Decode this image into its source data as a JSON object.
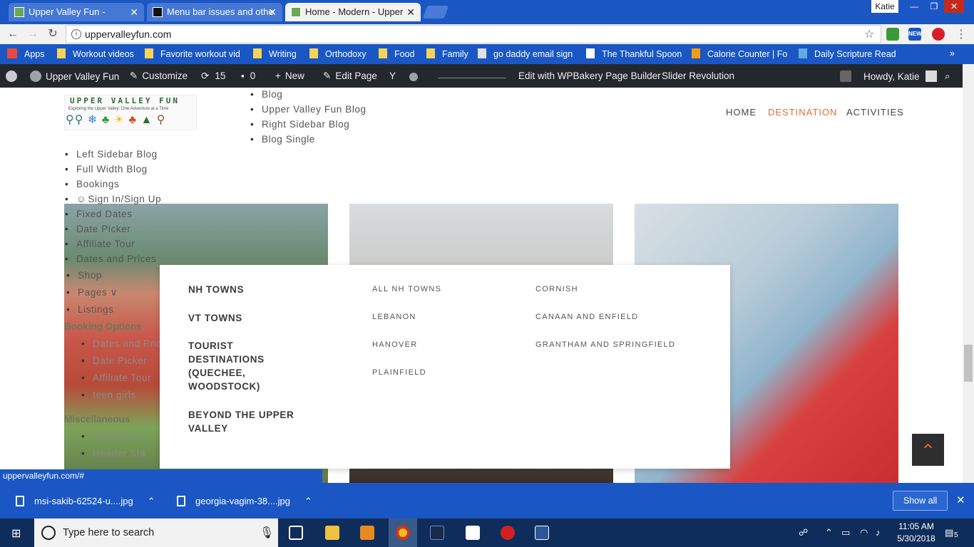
{
  "browser": {
    "tabs": [
      {
        "title": "Upper Valley Fun -",
        "active": false
      },
      {
        "title": "Menu bar issues and othe",
        "active": false
      },
      {
        "title": "Home - Modern - Upper",
        "active": true
      }
    ],
    "profile": "Katie",
    "url": "uppervalleyfun.com",
    "ext_new_label": "NEW"
  },
  "bookmarks": [
    "Apps",
    "Workout videos",
    "Favorite workout vid",
    "Writing",
    "Orthodoxy",
    "Food",
    "Family",
    "go daddy email sign",
    "The Thankful Spoon",
    "Calorie Counter | Fo",
    "Daily Scripture Read"
  ],
  "wpbar": {
    "site": "Upper Valley Fun",
    "customize": "Customize",
    "updates": "15",
    "comments": "0",
    "new": "New",
    "edit_page": "Edit Page",
    "wpbakery": "Edit with WPBakery Page Builder",
    "slider": "Slider Revolution",
    "howdy": "Howdy, Katie"
  },
  "site": {
    "logo_text": "UPPER VALLEY FUN",
    "logo_tagline": "Exploring the Upper Valley: One Adventure at a Time",
    "nav": [
      "HOME",
      "DESTINATION",
      "ACTIVITIES"
    ]
  },
  "overflow_list_top": [
    "Blog",
    "Upper Valley Fun Blog",
    "Right Sidebar Blog",
    "Blog Single"
  ],
  "overflow_list_left": [
    "Left Sidebar Blog",
    "Full Width Blog",
    "Bookings",
    "Sign In/Sign Up",
    "Fixed Dates",
    "Date Picker",
    "Affiliate Tour",
    "Dates and Prices"
  ],
  "overflow_list_left2": [
    "Shop",
    "Pages",
    "Listings"
  ],
  "booking_heading": "Booking Options",
  "booking_items": [
    "Dates and Price",
    "Date Picker",
    "Affiliate Tour",
    "teen girls"
  ],
  "misc_heading": "Miscellaneous",
  "misc_items": [
    "Contact Us",
    "Header Sta"
  ],
  "megamenu": {
    "main": [
      "NH TOWNS",
      "VT TOWNS",
      "TOURIST DESTINATIONS (QUECHEE, WOODSTOCK)",
      "BEYOND THE UPPER VALLEY"
    ],
    "col1": [
      "ALL NH TOWNS",
      "LEBANON",
      "HANOVER",
      "PLAINFIELD"
    ],
    "col2": [
      "CORNISH",
      "CANAAN AND ENFIELD",
      "GRANTHAM AND SPRINGFIELD"
    ]
  },
  "status_url": "uppervalleyfun.com/#",
  "downloads": [
    "msi-sakib-62524-u....jpg",
    "georgia-vagim-38....jpg"
  ],
  "show_all": "Show all",
  "taskbar": {
    "search_placeholder": "Type here to search",
    "time": "11:05 AM",
    "date": "5/30/2018",
    "notifications": "5"
  }
}
